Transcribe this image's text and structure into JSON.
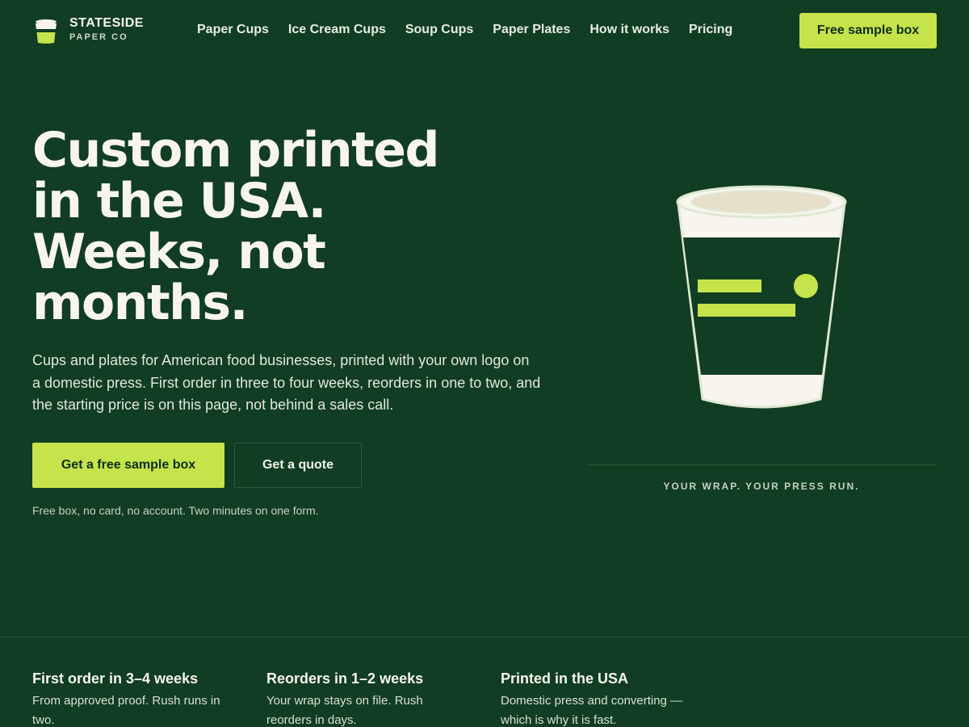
{
  "brand": {
    "name": "STATESIDE",
    "subtitle": "PAPER CO",
    "icon": "cup-logo-icon",
    "accent": "#c5e34a",
    "background": "#113d22"
  },
  "nav": {
    "links": [
      "Paper Cups",
      "Ice Cream Cups",
      "Soup Cups",
      "Paper Plates",
      "How it works",
      "Pricing"
    ],
    "cta": "Free sample box"
  },
  "hero": {
    "title_lines": [
      "Custom printed",
      "in the USA.",
      "Weeks, not",
      "months."
    ],
    "description": "Cups and plates for American food businesses, printed with your own logo on a domestic press. First order in three to four weeks, reorders in one to two, and the starting price is on this page, not behind a sales call.",
    "primary_button": "Get a free sample box",
    "secondary_button": "Get a quote",
    "fine_print": "Free box, no card, no account. Two minutes on one form.",
    "image_caption": "YOUR WRAP. YOUR PRESS RUN."
  },
  "features": [
    {
      "title": "First order in 3–4 weeks",
      "description": "From approved proof. Rush runs in two."
    },
    {
      "title": "Reorders in 1–2 weeks",
      "description": "Your wrap stays on file. Rush reorders in days."
    },
    {
      "title": "Printed in the USA",
      "description": "Domestic press and converting — which is why it is fast."
    }
  ]
}
